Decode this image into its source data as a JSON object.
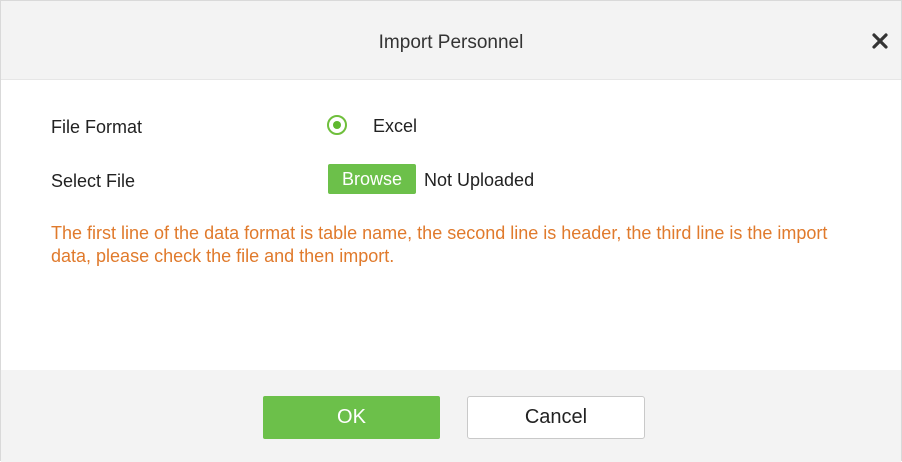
{
  "dialog": {
    "title": "Import Personnel",
    "close_icon": "close-icon"
  },
  "form": {
    "file_format": {
      "label": "File Format",
      "option_label": "Excel",
      "selected": true
    },
    "select_file": {
      "label": "Select File",
      "browse_label": "Browse",
      "status": "Not Uploaded"
    },
    "notice": "The first line of the data format is table name, the second line is header, the third line is the import data, please check the file and then import."
  },
  "footer": {
    "ok_label": "OK",
    "cancel_label": "Cancel"
  },
  "colors": {
    "accent_green": "#6cc04a",
    "notice_orange": "#e07a2c",
    "header_bg": "#f3f3f3"
  }
}
